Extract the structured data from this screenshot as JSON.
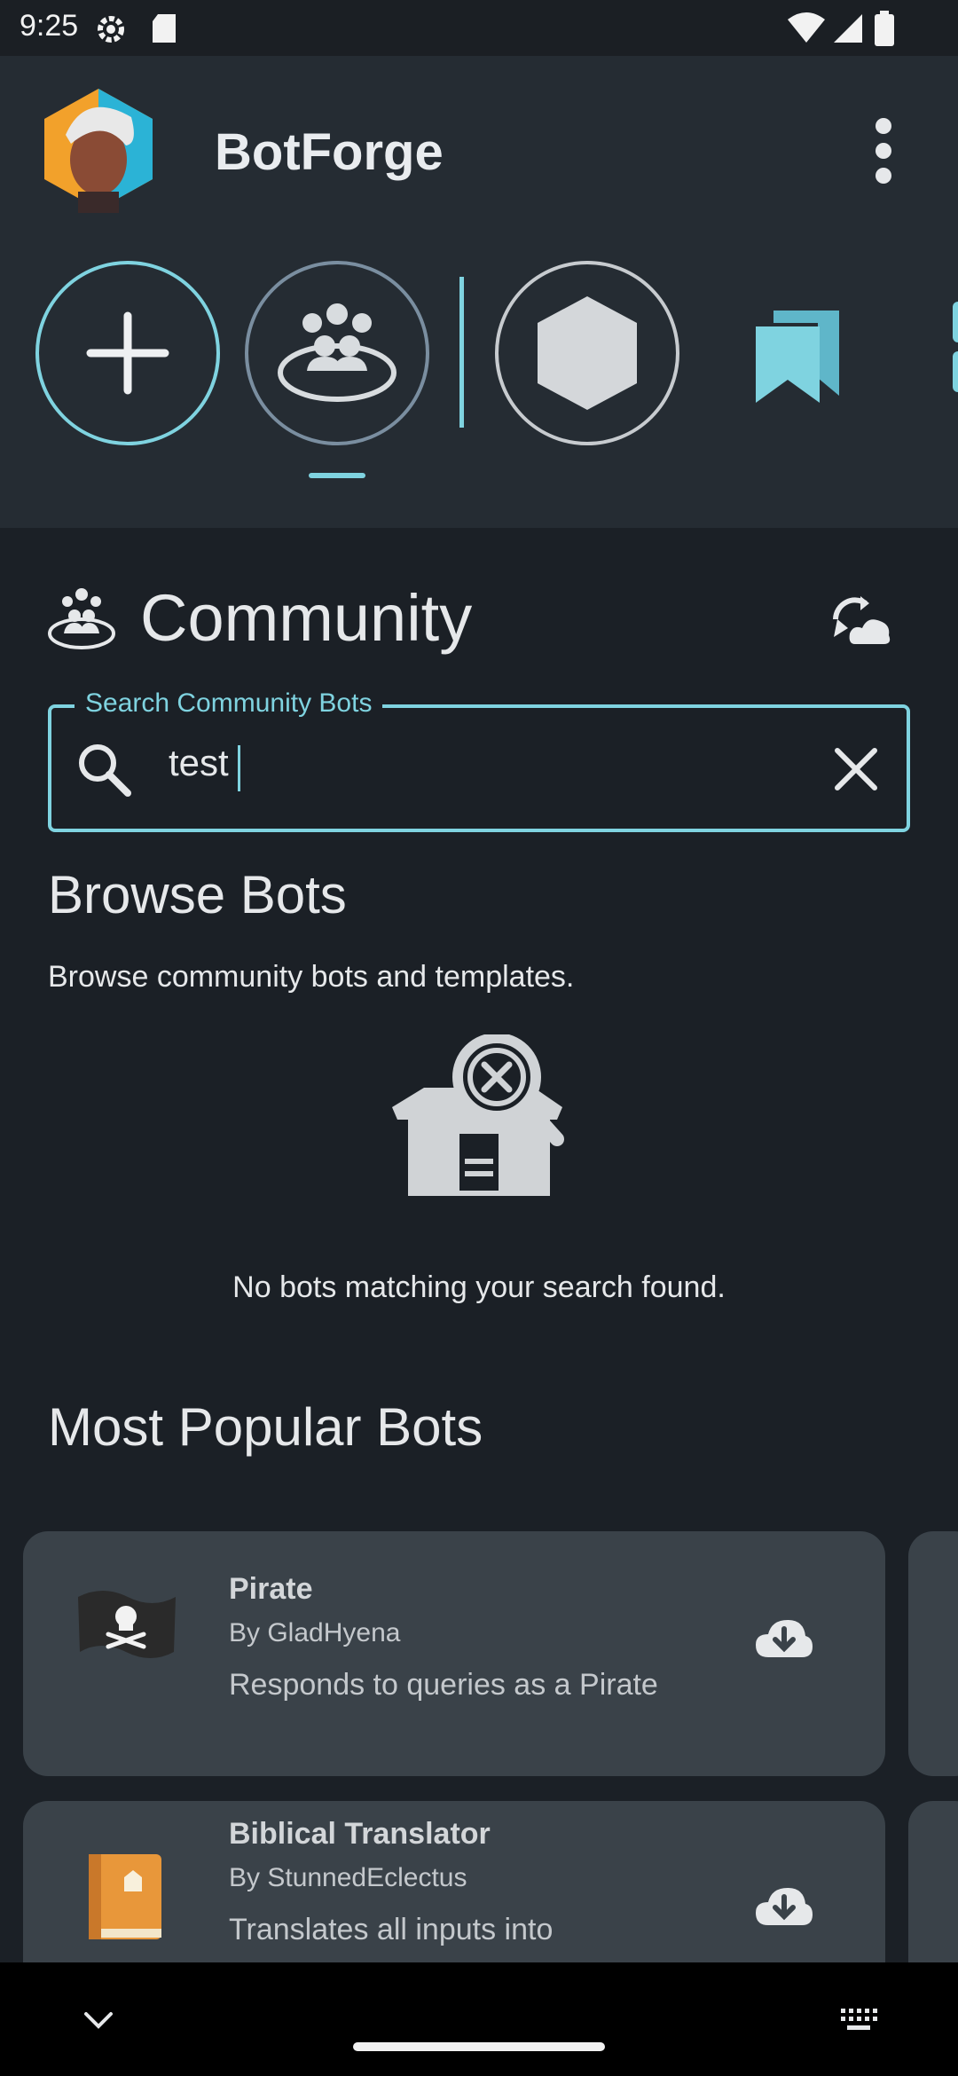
{
  "status_bar": {
    "time": "9:25"
  },
  "header": {
    "title": "BotForge"
  },
  "community": {
    "title": "Community",
    "search": {
      "label": "Search Community Bots",
      "value": "test"
    },
    "browse": {
      "heading": "Browse Bots",
      "subtitle": "Browse community bots and templates.",
      "empty_message": "No bots matching your search found."
    },
    "popular": {
      "heading": "Most Popular Bots",
      "bots": [
        {
          "name": "Pirate",
          "author": "By GladHyena",
          "description": "Responds to queries as a Pirate",
          "icon": "pirate-flag-icon"
        },
        {
          "name": "Biblical Translator",
          "author": "By StunnedEclectus",
          "description": "Translates all inputs into",
          "icon": "book-icon"
        }
      ]
    }
  },
  "colors": {
    "accent": "#7fd3e0",
    "background": "#1b2026",
    "header_bg": "#252c33",
    "card_bg": "#3a4249",
    "bookmark": "#7fd3e0"
  }
}
